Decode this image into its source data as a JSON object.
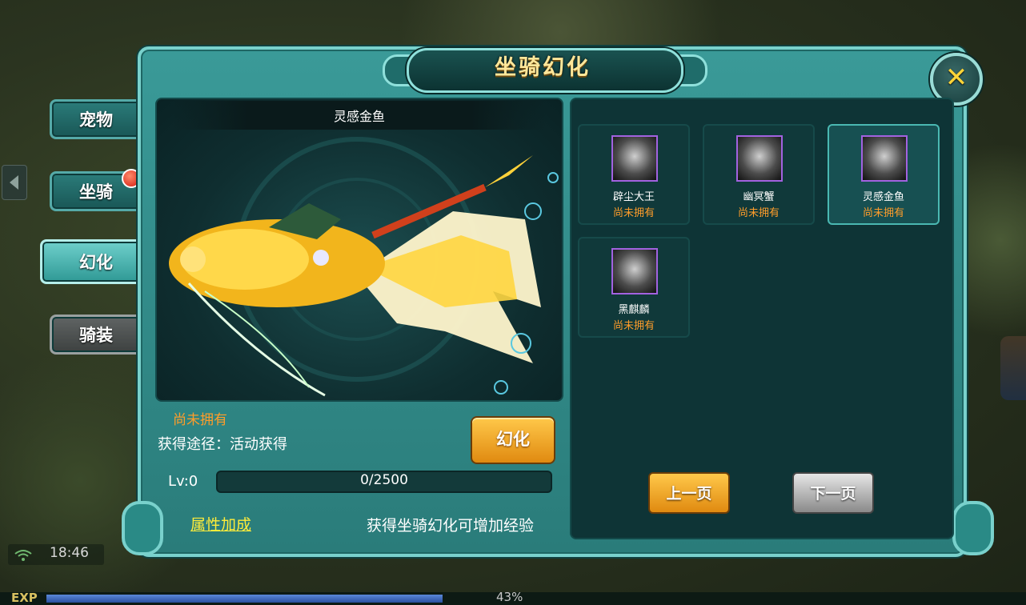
{
  "window": {
    "title": "坐骑幻化"
  },
  "side_tabs": [
    {
      "label": "宠物",
      "state": "normal"
    },
    {
      "label": "坐骑",
      "state": "normal",
      "has_badge": true
    },
    {
      "label": "幻化",
      "state": "active"
    },
    {
      "label": "骑装",
      "state": "disabled"
    }
  ],
  "preview": {
    "name": "灵感金鱼",
    "status": "尚未拥有",
    "source": "获得途径：活动获得",
    "transform_button": "幻化",
    "level_label": "Lv:0",
    "exp_text": "0/2500",
    "exp_progress": 0.0,
    "attr_link": "属性加成",
    "exp_tip": "获得坐骑幻化可增加经验"
  },
  "mounts": [
    {
      "name": "辟尘大王",
      "status": "尚未拥有",
      "selected": false
    },
    {
      "name": "幽冥蟹",
      "status": "尚未拥有",
      "selected": false
    },
    {
      "name": "灵感金鱼",
      "status": "尚未拥有",
      "selected": true
    },
    {
      "name": "黑麒麟",
      "status": "尚未拥有",
      "selected": false
    }
  ],
  "pagination": {
    "prev_label": "上一页",
    "next_label": "下一页"
  },
  "hud": {
    "time": "18:46",
    "exp_label": "EXP",
    "exp_percent": "43%",
    "exp_fill": 0.43
  },
  "colors": {
    "panel_teal": "#2a7c7a",
    "status_orange": "#ff9d2a",
    "title_gold": "#ffe79a",
    "link_yellow": "#ffec3a",
    "selected_border": "#4ab8b2",
    "icon_border_purple": "#a262e0"
  },
  "icons": {
    "close": "close-icon",
    "left_arrow": "chevron-left-icon",
    "wifi": "wifi-icon"
  }
}
